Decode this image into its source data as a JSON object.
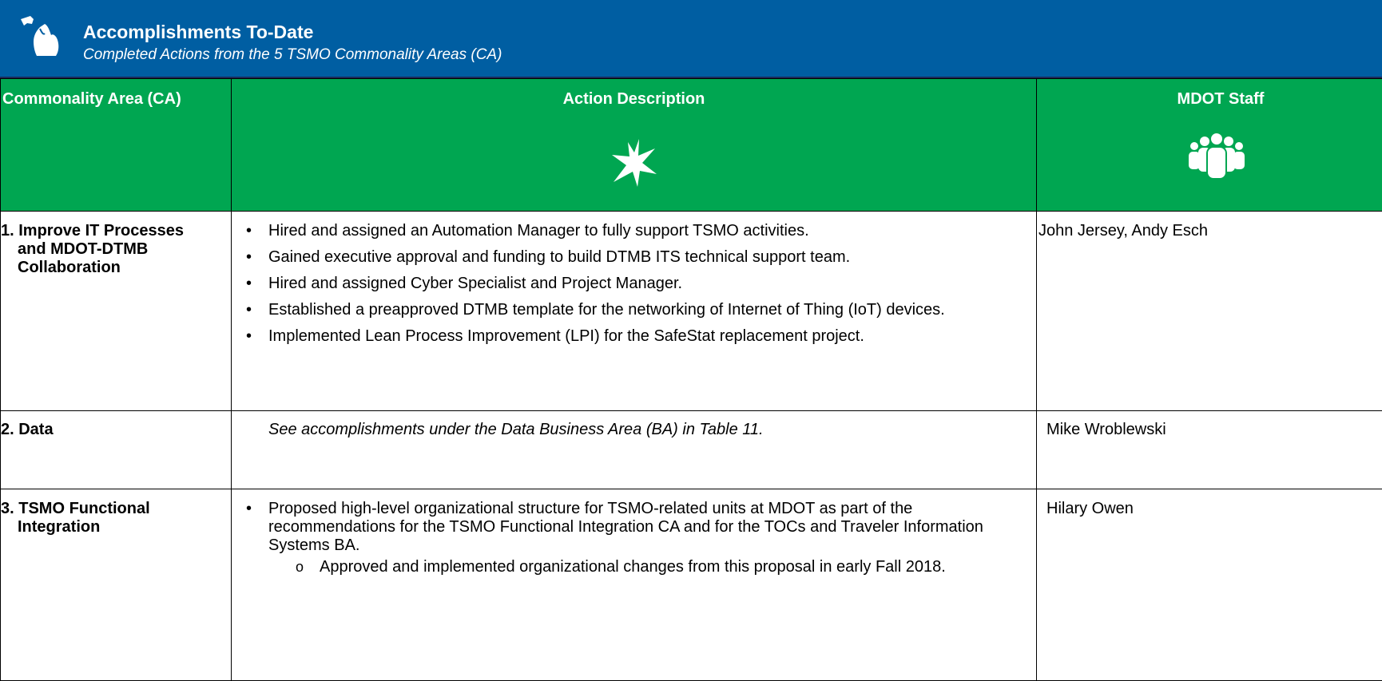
{
  "banner": {
    "title": "Accomplishments To-Date",
    "subtitle": "Completed Actions from the 5 TSMO Commonality Areas (CA)"
  },
  "table": {
    "headers": {
      "col1": "Commonality Area (CA)",
      "col2": "Action Description",
      "col3": "MDOT Staff"
    },
    "rows": [
      {
        "area_num": "1. Improve IT Processes",
        "area_rest": "and MDOT-DTMB Collaboration",
        "actions": [
          "Hired and assigned an Automation Manager to fully support TSMO activities.",
          "Gained executive approval and funding to build DTMB ITS technical support team.",
          "Hired and assigned Cyber Specialist and Project Manager.",
          "Established a preapproved DTMB template for the networking of Internet of Thing (IoT) devices.",
          "Implemented Lean Process Improvement (LPI) for the SafeStat replacement project."
        ],
        "staff": "John Jersey, Andy Esch"
      },
      {
        "area_num": "2. Data",
        "note": "See accomplishments under the Data Business Area (BA) in Table 11.",
        "staff": "Mike Wroblewski"
      },
      {
        "area_num": "3. TSMO Functional",
        "area_rest": "Integration",
        "actions": [
          "Proposed high-level organizational structure for TSMO-related units at MDOT as part of the recommendations for the TSMO Functional Integration CA and for the TOCs and Traveler Information Systems BA."
        ],
        "subactions": [
          "Approved and implemented organizational changes from this proposal in early Fall 2018."
        ],
        "staff": "Hilary Owen"
      }
    ]
  },
  "icons": {
    "logo": "michigan-state-icon",
    "action": "starburst-icon",
    "staff": "people-group-icon"
  }
}
